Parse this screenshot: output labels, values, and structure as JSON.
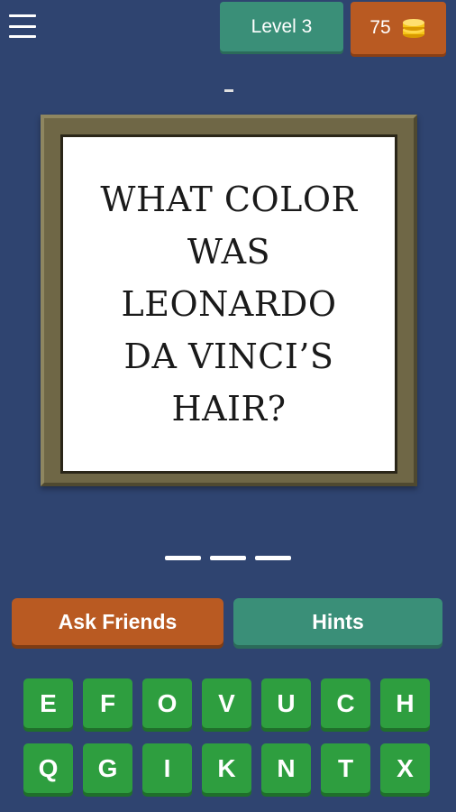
{
  "header": {
    "menu_icon": "hamburger-menu-icon",
    "level_label": "Level 3",
    "coins": "75",
    "coin_icon": "coin-stack-icon"
  },
  "question_placeholder": "-",
  "question": {
    "lines": [
      "WHAT COLOR",
      "WAS",
      "LEONARDO",
      "DA VINCI’S",
      "HAIR?"
    ]
  },
  "answer": {
    "slot_count": 3
  },
  "actions": {
    "ask_friends": "Ask Friends",
    "hints": "Hints"
  },
  "keyboard": {
    "rows": [
      [
        "E",
        "F",
        "O",
        "V",
        "U",
        "C",
        "H"
      ],
      [
        "Q",
        "G",
        "I",
        "K",
        "N",
        "T",
        "X"
      ]
    ]
  },
  "colors": {
    "background": "#2f4470",
    "level_badge": "#3a8f78",
    "coins_badge": "#b95a22",
    "ask_button": "#b95a22",
    "hints_button": "#3a8f78",
    "key": "#2e9e3f"
  }
}
